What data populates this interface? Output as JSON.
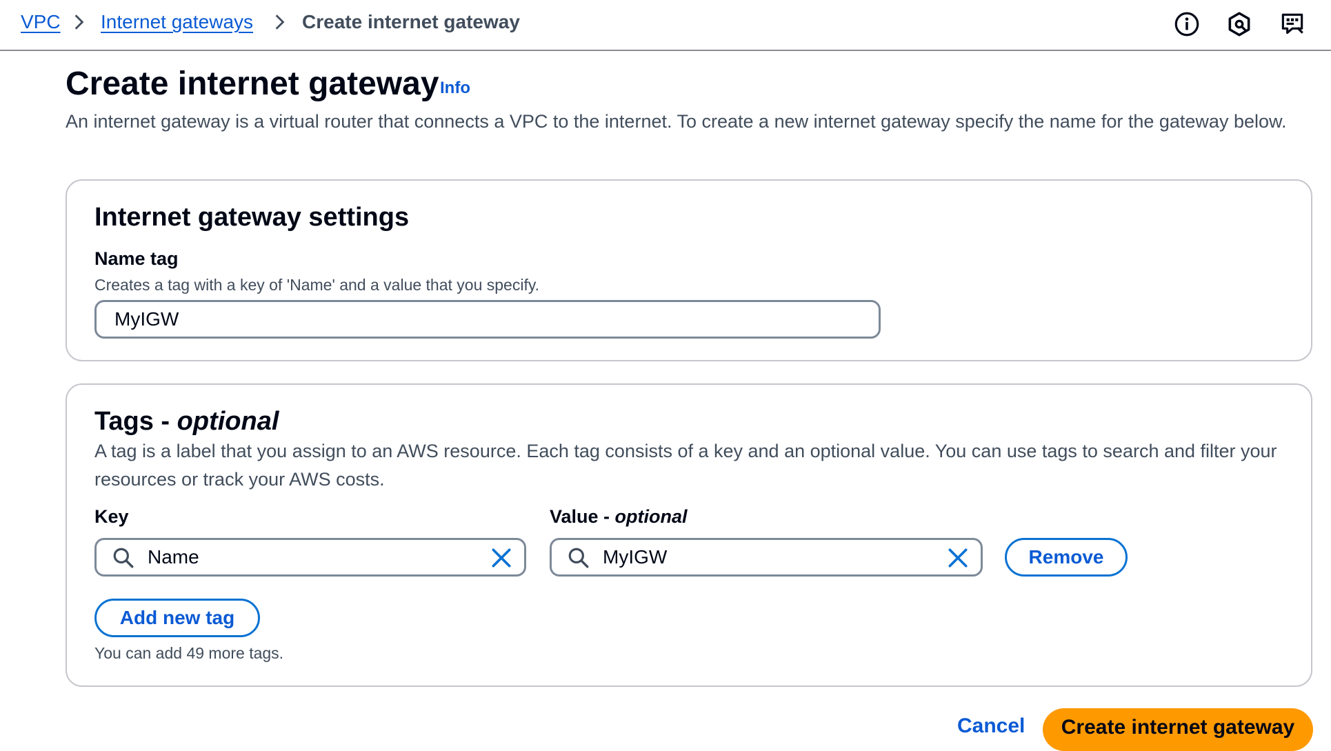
{
  "breadcrumb": {
    "items": [
      {
        "label": "VPC"
      },
      {
        "label": "Internet gateways"
      },
      {
        "label": "Create internet gateway"
      }
    ]
  },
  "header": {
    "icons": [
      "info-circle-icon",
      "settings-hexagon-icon",
      "feedback-icon"
    ]
  },
  "page": {
    "title": "Create internet gateway",
    "info_link": "Info",
    "description": "An internet gateway is a virtual router that connects a VPC to the internet. To create a new internet gateway specify the name for the gateway below."
  },
  "settings": {
    "title": "Internet gateway settings",
    "name_tag_label": "Name tag",
    "name_tag_description": "Creates a tag with a key of 'Name' and a value that you specify.",
    "name_tag_value": "MyIGW"
  },
  "tags": {
    "title_main": "Tags - ",
    "title_optional": "optional",
    "description": "A tag is a label that you assign to an AWS resource. Each tag consists of a key and an optional value. You can use tags to search and filter your resources or track your AWS costs.",
    "key_label": "Key",
    "value_label_main": "Value - ",
    "value_label_optional": "optional",
    "rows": [
      {
        "key": "Name",
        "value": "MyIGW",
        "remove_label": "Remove"
      }
    ],
    "add_label": "Add new tag",
    "remaining_hint": "You can add 49 more tags."
  },
  "footer": {
    "cancel_label": "Cancel",
    "submit_label": "Create internet gateway"
  },
  "colors": {
    "link": "#0a5ad4",
    "primary_button": "#ff9900",
    "text": "#000716",
    "secondary_text": "#414d5c"
  }
}
